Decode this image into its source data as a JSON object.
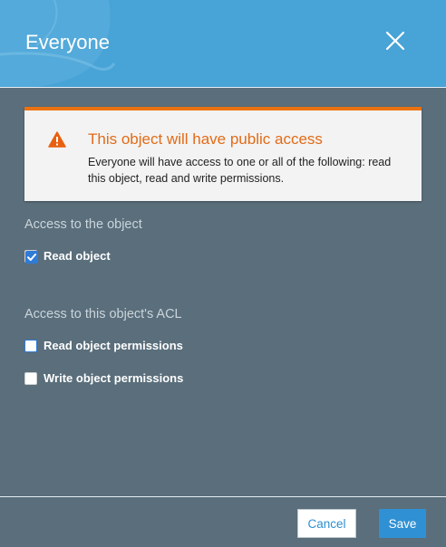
{
  "header": {
    "title": "Everyone"
  },
  "alert": {
    "title": "This object will have public access",
    "body": "Everyone will have access to one or all of the following: read this object, read and write permissions."
  },
  "sections": {
    "object_access": {
      "label": "Access to the object",
      "items": [
        {
          "label": "Read object",
          "checked": true
        }
      ]
    },
    "acl_access": {
      "label": "Access to this object's ACL",
      "items": [
        {
          "label": "Read object permissions",
          "checked": false
        },
        {
          "label": "Write object permissions",
          "checked": false
        }
      ]
    }
  },
  "footer": {
    "cancel_label": "Cancel",
    "save_label": "Save"
  },
  "colors": {
    "header": "#48a3d6",
    "panel": "#5a6e7b",
    "warning": "#ec7211",
    "primary": "#2f90d3"
  },
  "icons": {
    "close": "close-icon",
    "warning": "warning-icon",
    "check": "checkmark-icon"
  }
}
